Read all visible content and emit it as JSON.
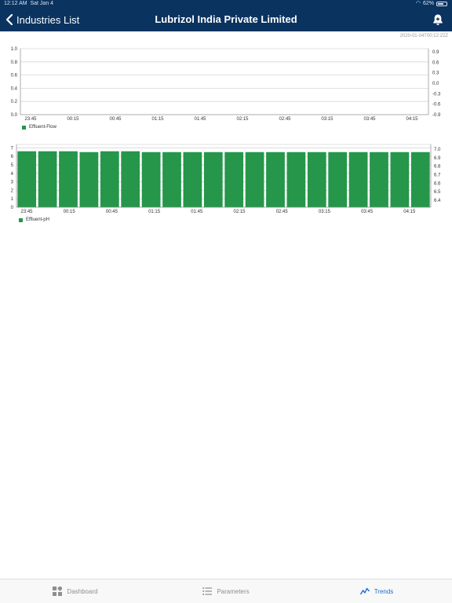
{
  "status": {
    "time": "12:12 AM",
    "date": "Sat Jan 4",
    "battery": "62%"
  },
  "nav": {
    "back_label": "Industries List",
    "title": "Lubrizol India Private Limited"
  },
  "timestamp": "2020-01-04T00:12:22Z",
  "chart_data": [
    {
      "type": "line",
      "title": "",
      "x_ticks": [
        "23:45",
        "00:15",
        "00:45",
        "01:15",
        "01:45",
        "02:15",
        "02:45",
        "03:15",
        "03:45",
        "04:15"
      ],
      "y_left_ticks": [
        "1.0",
        "0.8",
        "0.6",
        "0.4",
        "0.2",
        "0.0"
      ],
      "y_right_ticks": [
        "0.9",
        "0.6",
        "0.3",
        "0.0",
        "-0.3",
        "-0.6",
        "-0.9"
      ],
      "ylim": [
        0,
        1
      ],
      "series": [
        {
          "name": "Effluent-Flow",
          "values": []
        }
      ],
      "legend": "bottom-left",
      "color": "#25964a"
    },
    {
      "type": "bar",
      "title": "",
      "x_ticks": [
        "23:45",
        "00:15",
        "00:45",
        "01:15",
        "01:45",
        "02:15",
        "02:45",
        "03:15",
        "03:45",
        "04:15"
      ],
      "y_left_ticks": [
        "7",
        "6",
        "5",
        "4",
        "3",
        "2",
        "1",
        "0"
      ],
      "y_right_ticks": [
        "7.0",
        "6.9",
        "6.8",
        "6.7",
        "6.6",
        "6.5",
        "6.4"
      ],
      "ylim": [
        0,
        7.4
      ],
      "series": [
        {
          "name": "Effluent-pH",
          "values": [
            6.6,
            6.6,
            6.6,
            6.5,
            6.6,
            6.6,
            6.5,
            6.5,
            6.5,
            6.5,
            6.5,
            6.5,
            6.5,
            6.5,
            6.5,
            6.5,
            6.5,
            6.5,
            6.5,
            6.5
          ]
        }
      ],
      "legend": "bottom-left",
      "color": "#25964a"
    }
  ],
  "tabs": [
    {
      "label": "Dashboard",
      "icon": "dashboard-icon",
      "active": false
    },
    {
      "label": "Parameters",
      "icon": "list-icon",
      "active": false
    },
    {
      "label": "Trends",
      "icon": "trends-icon",
      "active": true
    }
  ],
  "colors": {
    "nav_bg": "#0a3360",
    "bar": "#25964a",
    "accent": "#1a6fd6"
  }
}
